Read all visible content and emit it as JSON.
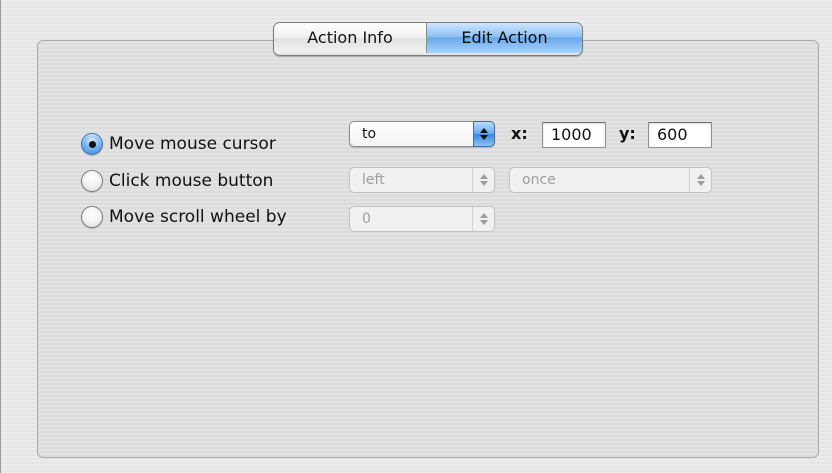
{
  "tabs": {
    "action_info": "Action Info",
    "edit_action": "Edit Action"
  },
  "options": {
    "move_cursor": {
      "label": "Move mouse cursor",
      "selected": true
    },
    "click_button": {
      "label": "Click mouse button",
      "selected": false
    },
    "scroll_wheel": {
      "label": "Move scroll wheel by",
      "selected": false
    }
  },
  "move_cursor_controls": {
    "mode_value": "to",
    "x_label": "x:",
    "x_value": "1000",
    "y_label": "y:",
    "y_value": "600"
  },
  "click_controls": {
    "button_value": "left",
    "count_value": "once"
  },
  "scroll_controls": {
    "amount_value": "0"
  },
  "colors": {
    "active_tab": "#6aa8ec",
    "selected_radio": "#3b82d6"
  }
}
